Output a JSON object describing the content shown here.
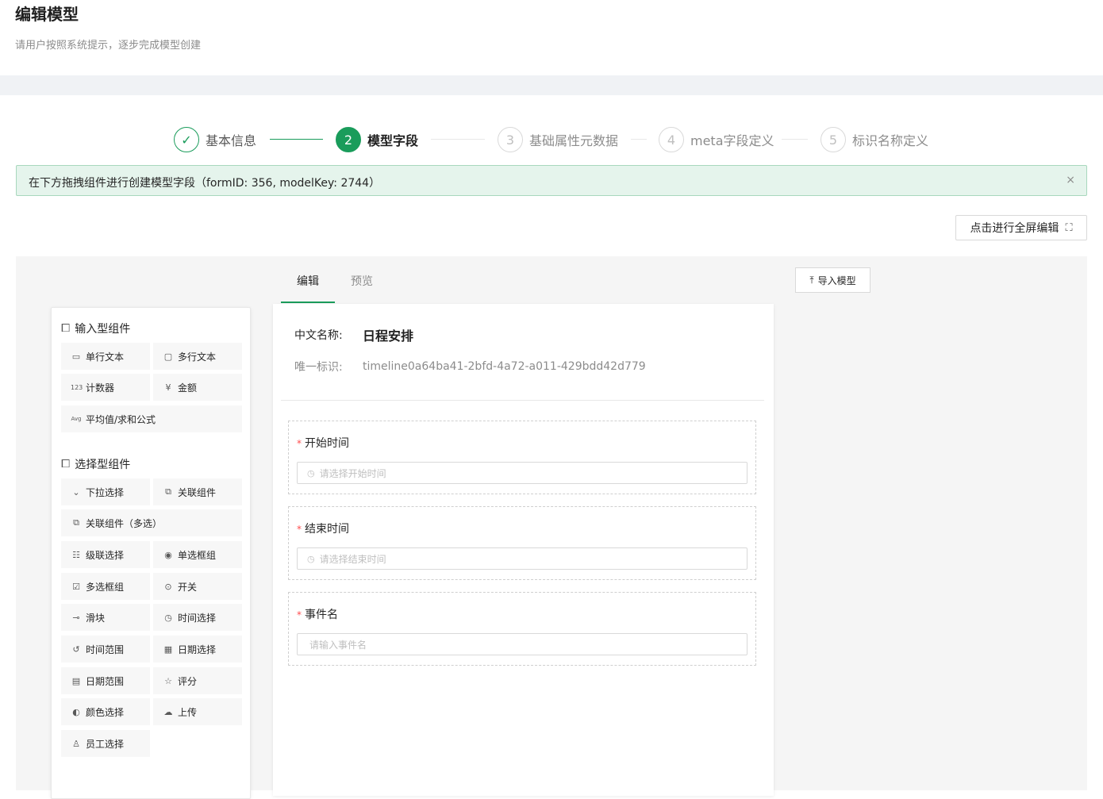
{
  "header": {
    "title": "编辑模型",
    "subtitle": "请用户按照系统提示，逐步完成模型创建"
  },
  "steps": [
    {
      "num": "✓",
      "label": "基本信息",
      "state": "done"
    },
    {
      "num": "2",
      "label": "模型字段",
      "state": "active"
    },
    {
      "num": "3",
      "label": "基础属性元数据",
      "state": "wait"
    },
    {
      "num": "4",
      "label": "meta字段定义",
      "state": "wait"
    },
    {
      "num": "5",
      "label": "标识名称定义",
      "state": "wait"
    }
  ],
  "alert": {
    "text": "在下方拖拽组件进行创建模型字段（formID: 356, modelKey: 2744）",
    "close": "×"
  },
  "toolbar": {
    "fullscreen_label": "点击进行全屏编辑",
    "fullscreen_icon": "⛶",
    "import_label": "导入模型",
    "import_icon": "⤒"
  },
  "tabs": {
    "edit": "编辑",
    "preview": "预览"
  },
  "palette": {
    "input_group": {
      "title": "输入型组件",
      "items": [
        {
          "label": "单行文本",
          "icon": "▭"
        },
        {
          "label": "多行文本",
          "icon": "▢"
        },
        {
          "label": "计数器",
          "icon": "123"
        },
        {
          "label": "金额",
          "icon": "¥"
        },
        {
          "label": "平均值/求和公式",
          "icon": "Avg"
        }
      ]
    },
    "select_group": {
      "title": "选择型组件",
      "items": [
        {
          "label": "下拉选择",
          "icon": "⌄"
        },
        {
          "label": "关联组件",
          "icon": "⧉"
        },
        {
          "label": "关联组件（多选）",
          "icon": "⧉"
        },
        {
          "label": "级联选择",
          "icon": "☷"
        },
        {
          "label": "单选框组",
          "icon": "◉"
        },
        {
          "label": "多选框组",
          "icon": "☑"
        },
        {
          "label": "开关",
          "icon": "⊙"
        },
        {
          "label": "滑块",
          "icon": "⊸"
        },
        {
          "label": "时间选择",
          "icon": "◷"
        },
        {
          "label": "时间范围",
          "icon": "↺"
        },
        {
          "label": "日期选择",
          "icon": "▦"
        },
        {
          "label": "日期范围",
          "icon": "▤"
        },
        {
          "label": "评分",
          "icon": "☆"
        },
        {
          "label": "颜色选择",
          "icon": "◐"
        },
        {
          "label": "上传",
          "icon": "☁"
        },
        {
          "label": "员工选择",
          "icon": "♙"
        }
      ]
    }
  },
  "model": {
    "name_label": "中文名称:",
    "name_value": "日程安排",
    "key_label": "唯一标识:",
    "key_value": "timeline0a64ba41-2bfd-4a72-a011-429bdd42d779"
  },
  "fields": [
    {
      "label": "开始时间",
      "required": "*",
      "placeholder": "请选择开始时间",
      "icon": "◷"
    },
    {
      "label": "结束时间",
      "required": "*",
      "placeholder": "请选择结束时间",
      "icon": "◷"
    },
    {
      "label": "事件名",
      "required": "*",
      "placeholder": "请输入事件名",
      "icon": ""
    }
  ],
  "colors": {
    "primary": "#1a9c5b",
    "alert_bg": "#e5f4ec",
    "required": "#ff4d4f"
  }
}
